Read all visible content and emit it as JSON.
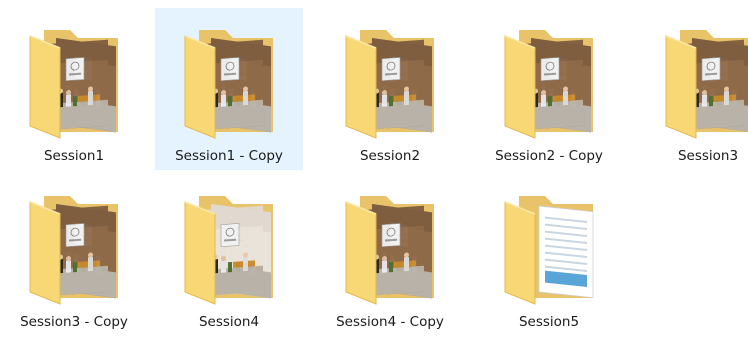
{
  "explorer": {
    "items": [
      {
        "name": "Session1",
        "thumb": "photo",
        "selected": false
      },
      {
        "name": "Session1 - Copy",
        "thumb": "photo",
        "selected": true
      },
      {
        "name": "Session2",
        "thumb": "photo",
        "selected": false
      },
      {
        "name": "Session2 - Copy",
        "thumb": "photo",
        "selected": false
      },
      {
        "name": "Session3",
        "thumb": "photo",
        "selected": false
      },
      {
        "name": "Session3 - Copy",
        "thumb": "photo",
        "selected": false
      },
      {
        "name": "Session4",
        "thumb": "photo-light",
        "selected": false
      },
      {
        "name": "Session4 - Copy",
        "thumb": "photo",
        "selected": false
      },
      {
        "name": "Session5",
        "thumb": "document",
        "selected": false
      }
    ],
    "colors": {
      "selection": "#e5f3ff",
      "folder_back": "#e8c36a",
      "folder_front": "#f8d775",
      "folder_edge": "#e3b94f"
    },
    "icon": "folder-icon"
  }
}
